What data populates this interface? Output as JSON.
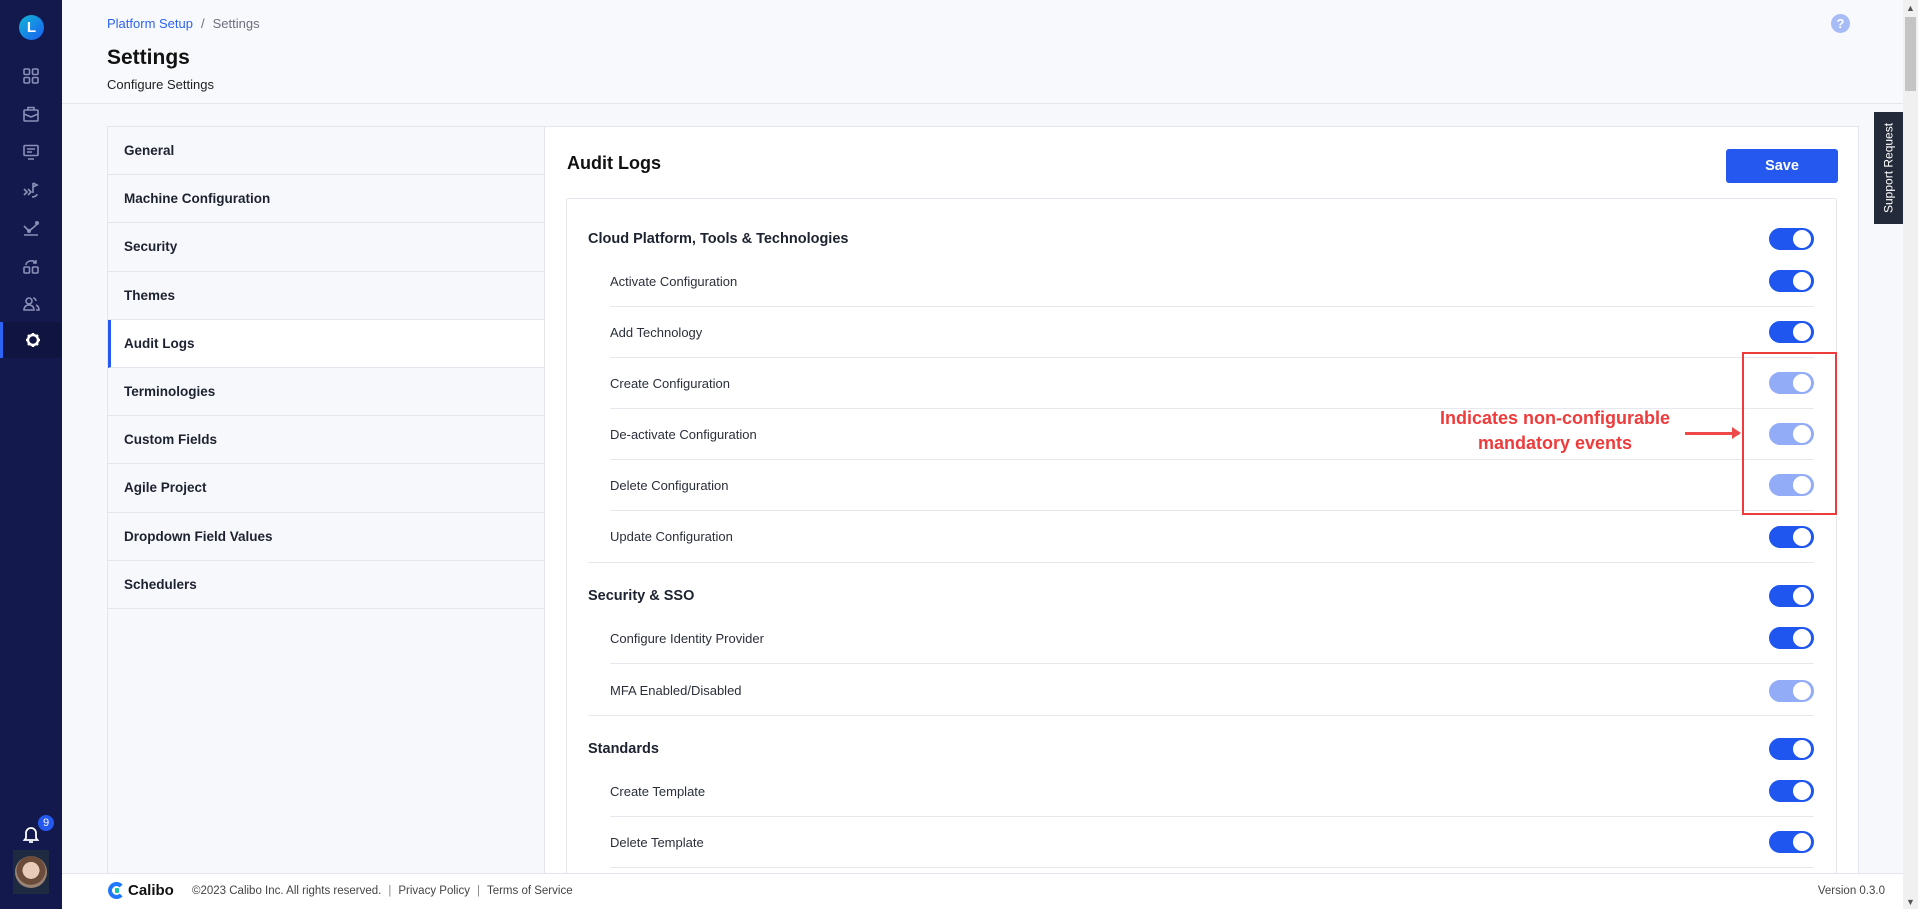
{
  "rail": {
    "logo_letter": "L",
    "icons": [
      "dashboard-icon",
      "briefcase-icon",
      "monitor-icon",
      "deploy-icon",
      "analytics-icon",
      "workflow-icon",
      "users-icon",
      "settings-icon"
    ],
    "active_icon": "settings-icon",
    "notifications_count": "9"
  },
  "header": {
    "breadcrumb": [
      {
        "label": "Platform Setup",
        "link": true
      },
      {
        "label": "Settings",
        "link": false
      }
    ],
    "breadcrumb_separator": "/",
    "title": "Settings",
    "subtitle": "Configure Settings",
    "help_icon": "?"
  },
  "support_tab": "Support Request",
  "settings_nav": {
    "items": [
      {
        "label": "General"
      },
      {
        "label": "Machine Configuration"
      },
      {
        "label": "Security"
      },
      {
        "label": "Themes"
      },
      {
        "label": "Audit Logs",
        "active": true
      },
      {
        "label": "Terminologies"
      },
      {
        "label": "Custom Fields"
      },
      {
        "label": "Agile Project"
      },
      {
        "label": "Dropdown Field Values"
      },
      {
        "label": "Schedulers"
      }
    ]
  },
  "content": {
    "title": "Audit Logs",
    "save_label": "Save",
    "groups": [
      {
        "label": "Cloud Platform, Tools & Technologies",
        "enabled": true,
        "items": [
          {
            "label": "Activate Configuration",
            "enabled": true,
            "mandatory": false
          },
          {
            "label": "Add Technology",
            "enabled": true,
            "mandatory": false
          },
          {
            "label": "Create Configuration",
            "enabled": true,
            "mandatory": true
          },
          {
            "label": "De-activate Configuration",
            "enabled": true,
            "mandatory": true
          },
          {
            "label": "Delete Configuration",
            "enabled": true,
            "mandatory": true
          },
          {
            "label": "Update Configuration",
            "enabled": true,
            "mandatory": false
          }
        ]
      },
      {
        "label": "Security & SSO",
        "enabled": true,
        "items": [
          {
            "label": "Configure Identity Provider",
            "enabled": true,
            "mandatory": false
          },
          {
            "label": "MFA Enabled/Disabled",
            "enabled": true,
            "mandatory": true
          }
        ]
      },
      {
        "label": "Standards",
        "enabled": true,
        "items": [
          {
            "label": "Create Template",
            "enabled": true,
            "mandatory": false
          },
          {
            "label": "Delete Template",
            "enabled": true,
            "mandatory": false
          }
        ]
      }
    ]
  },
  "annotation": {
    "text_line1": "Indicates non-configurable",
    "text_line2": "mandatory events",
    "color": "#ee3b3b"
  },
  "footer": {
    "brand": "Calibo",
    "copyright": "©2023 Calibo Inc. All rights reserved.",
    "privacy": "Privacy Policy",
    "terms": "Terms of Service",
    "separator": "|",
    "version": "Version 0.3.0"
  },
  "colors": {
    "accent": "#2458ef",
    "toggle_on": "#1f56f0",
    "toggle_disabled": "#93acf7",
    "rail_bg": "#13194d"
  }
}
